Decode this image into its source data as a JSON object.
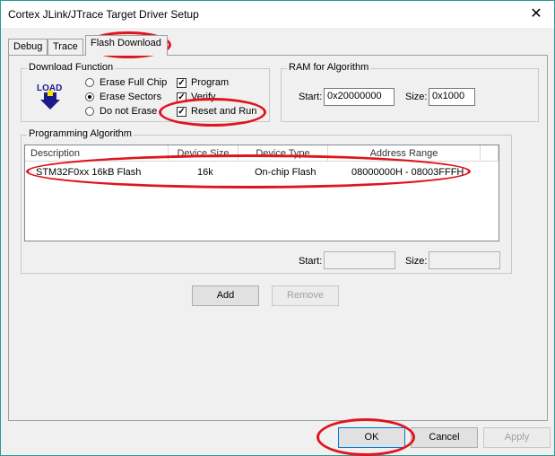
{
  "window": {
    "title": "Cortex JLink/JTrace Target Driver Setup",
    "close_glyph": "✕"
  },
  "tabs": [
    {
      "label": "Debug"
    },
    {
      "label": "Trace"
    },
    {
      "label": "Flash Download"
    }
  ],
  "download_function": {
    "legend": "Download Function",
    "icon_text": "LOAD",
    "radios": [
      {
        "label": "Erase Full Chip",
        "selected": false
      },
      {
        "label": "Erase Sectors",
        "selected": true
      },
      {
        "label": "Do not Erase",
        "selected": false
      }
    ],
    "checks": [
      {
        "label": "Program",
        "checked": true
      },
      {
        "label": "Verify",
        "checked": true
      },
      {
        "label": "Reset and Run",
        "checked": true
      }
    ]
  },
  "ram": {
    "legend": "RAM for Algorithm",
    "start_label": "Start:",
    "start_value": "0x20000000",
    "size_label": "Size:",
    "size_value": "0x1000"
  },
  "programming": {
    "legend": "Programming Algorithm",
    "columns": [
      "Description",
      "Device Size",
      "Device Type",
      "Address Range"
    ],
    "rows": [
      {
        "description": "STM32F0xx 16kB Flash",
        "size": "16k",
        "type": "On-chip Flash",
        "range": "08000000H - 08003FFFH"
      }
    ],
    "start_label": "Start:",
    "size_label": "Size:",
    "add_label": "Add",
    "remove_label": "Remove"
  },
  "footer": {
    "ok_label": "OK",
    "cancel_label": "Cancel",
    "apply_label": "Apply"
  },
  "colors": {
    "annotation": "#e0141e",
    "accent": "#0078d7"
  }
}
